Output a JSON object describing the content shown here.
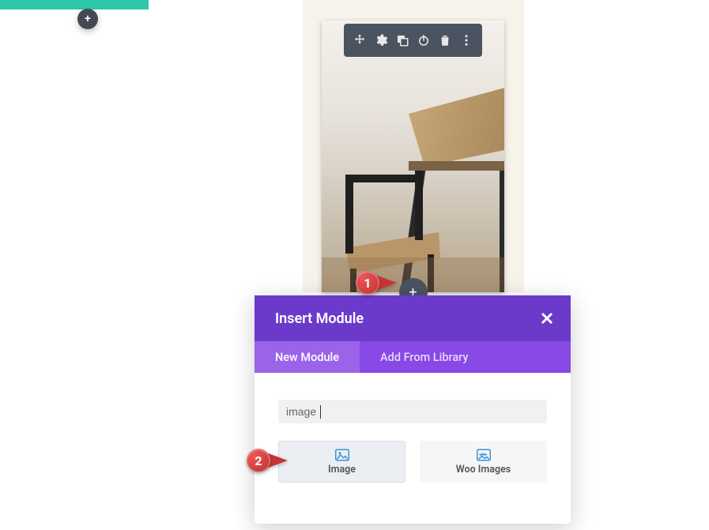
{
  "annotations": {
    "one": "1",
    "two": "2"
  },
  "top_toolbar": {
    "add": "+"
  },
  "module_toolbar": {
    "icons": [
      "move",
      "settings",
      "duplicate",
      "power",
      "delete",
      "more"
    ]
  },
  "module_add": "+",
  "modal": {
    "title": "Insert Module",
    "close": "×",
    "tabs": {
      "new_module": "New Module",
      "add_from_library": "Add From Library"
    },
    "search": {
      "value": "image",
      "placeholder": ""
    },
    "cards": {
      "image": "Image",
      "woo_images": "Woo Images"
    }
  }
}
